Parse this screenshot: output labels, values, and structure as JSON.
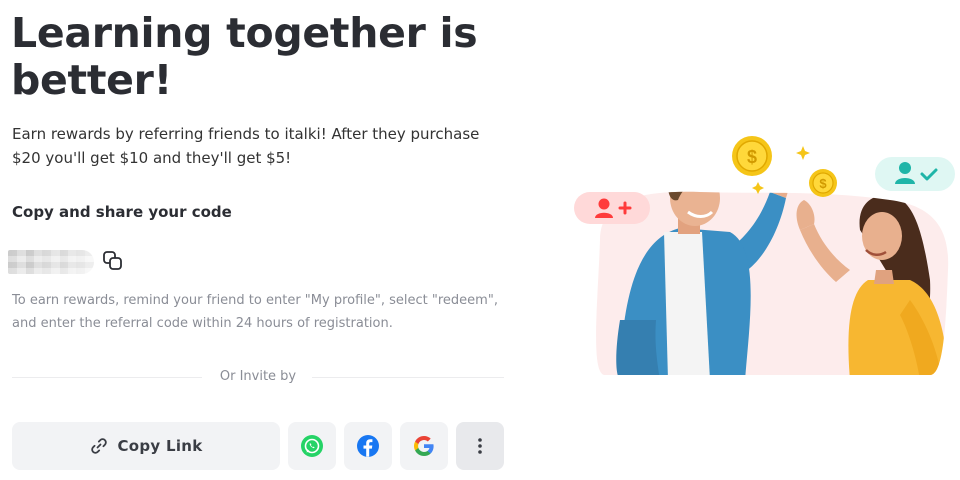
{
  "header": {
    "title": "Learning together is better!"
  },
  "intro": {
    "text": "Earn rewards by referring friends to italki! After they purchase $20 you'll get $10 and they'll get $5!"
  },
  "copy_section": {
    "heading": "Copy and share your code"
  },
  "hint": {
    "text": "To earn rewards, remind your friend to enter \"My profile\", select \"redeem\", and enter the referral code within 24 hours of registration."
  },
  "invite": {
    "label": "Or Invite by"
  },
  "actions": {
    "copy_link_label": "Copy Link",
    "share_buttons": [
      "whatsapp-icon",
      "facebook-icon",
      "google-icon",
      "more-vertical-icon"
    ]
  },
  "icons": {
    "copy_code": "copy-icon",
    "copy_link": "link-icon"
  },
  "colors": {
    "whatsapp": "#25D366",
    "facebook": "#1877F2",
    "accent_red": "#ff3b3b",
    "accent_teal": "#1fb5a8",
    "coin": "#f5c518"
  }
}
